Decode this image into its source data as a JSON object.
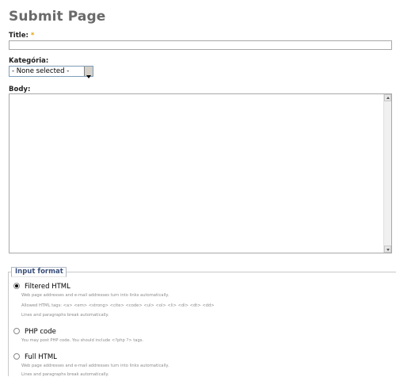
{
  "page": {
    "title": "Submit Page"
  },
  "form": {
    "title_label": "Title:",
    "required_mark": "*",
    "title_value": "",
    "category_label": "Kategória:",
    "category_selected": "- None selected -",
    "body_label": "Body:",
    "body_value": ""
  },
  "input_format": {
    "legend": "Input format",
    "options": [
      {
        "label": "Filtered HTML",
        "selected": true,
        "descriptions": [
          "Web page addresses and e-mail addresses turn into links automatically.",
          "Allowed HTML tags: <a> <em> <strong> <cite> <code> <ul> <ol> <li> <dl> <dt> <dd>",
          "Lines and paragraphs break automatically."
        ]
      },
      {
        "label": "PHP code",
        "selected": false,
        "descriptions": [
          "You may post PHP code. You should include <?php ?> tags."
        ]
      },
      {
        "label": "Full HTML",
        "selected": false,
        "descriptions": [
          "Web page addresses and e-mail addresses turn into links automatically.",
          "Lines and paragraphs break automatically."
        ]
      }
    ]
  },
  "icons": {
    "select_arrow": "chevron-down-icon",
    "scroll_up": "scroll-up-icon",
    "scroll_down": "scroll-down-icon"
  }
}
